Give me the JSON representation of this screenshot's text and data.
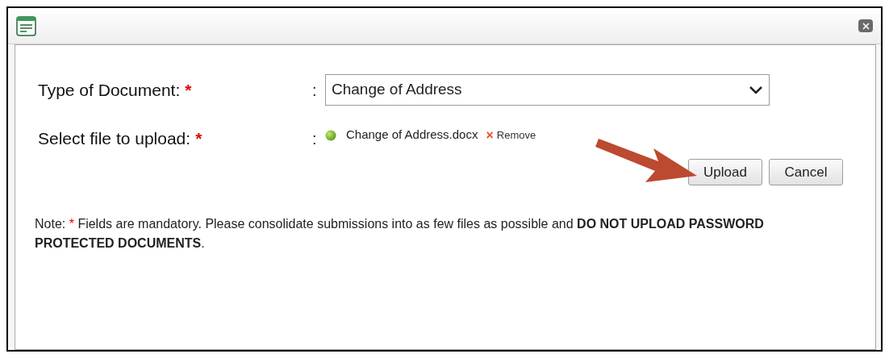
{
  "fields": [
    {
      "kind": "select",
      "label": "Type of Document:",
      "required_mark": "*",
      "separator": ":",
      "value": "Change of Address"
    },
    {
      "kind": "file",
      "label": "Select file to upload:",
      "required_mark": "*",
      "separator": ":",
      "file_name": "Change of Address.docx",
      "remove_icon": "×",
      "remove_label": "Remove"
    }
  ],
  "buttons": [
    "Upload",
    "Cancel"
  ],
  "note": {
    "prefix": "Note:",
    "mark": "*",
    "text": "Fields are mandatory. Please consolidate submissions into as few files as possible and **DO NOT UPLOAD PASSWORD PROTECTED DOCUMENTS**."
  }
}
